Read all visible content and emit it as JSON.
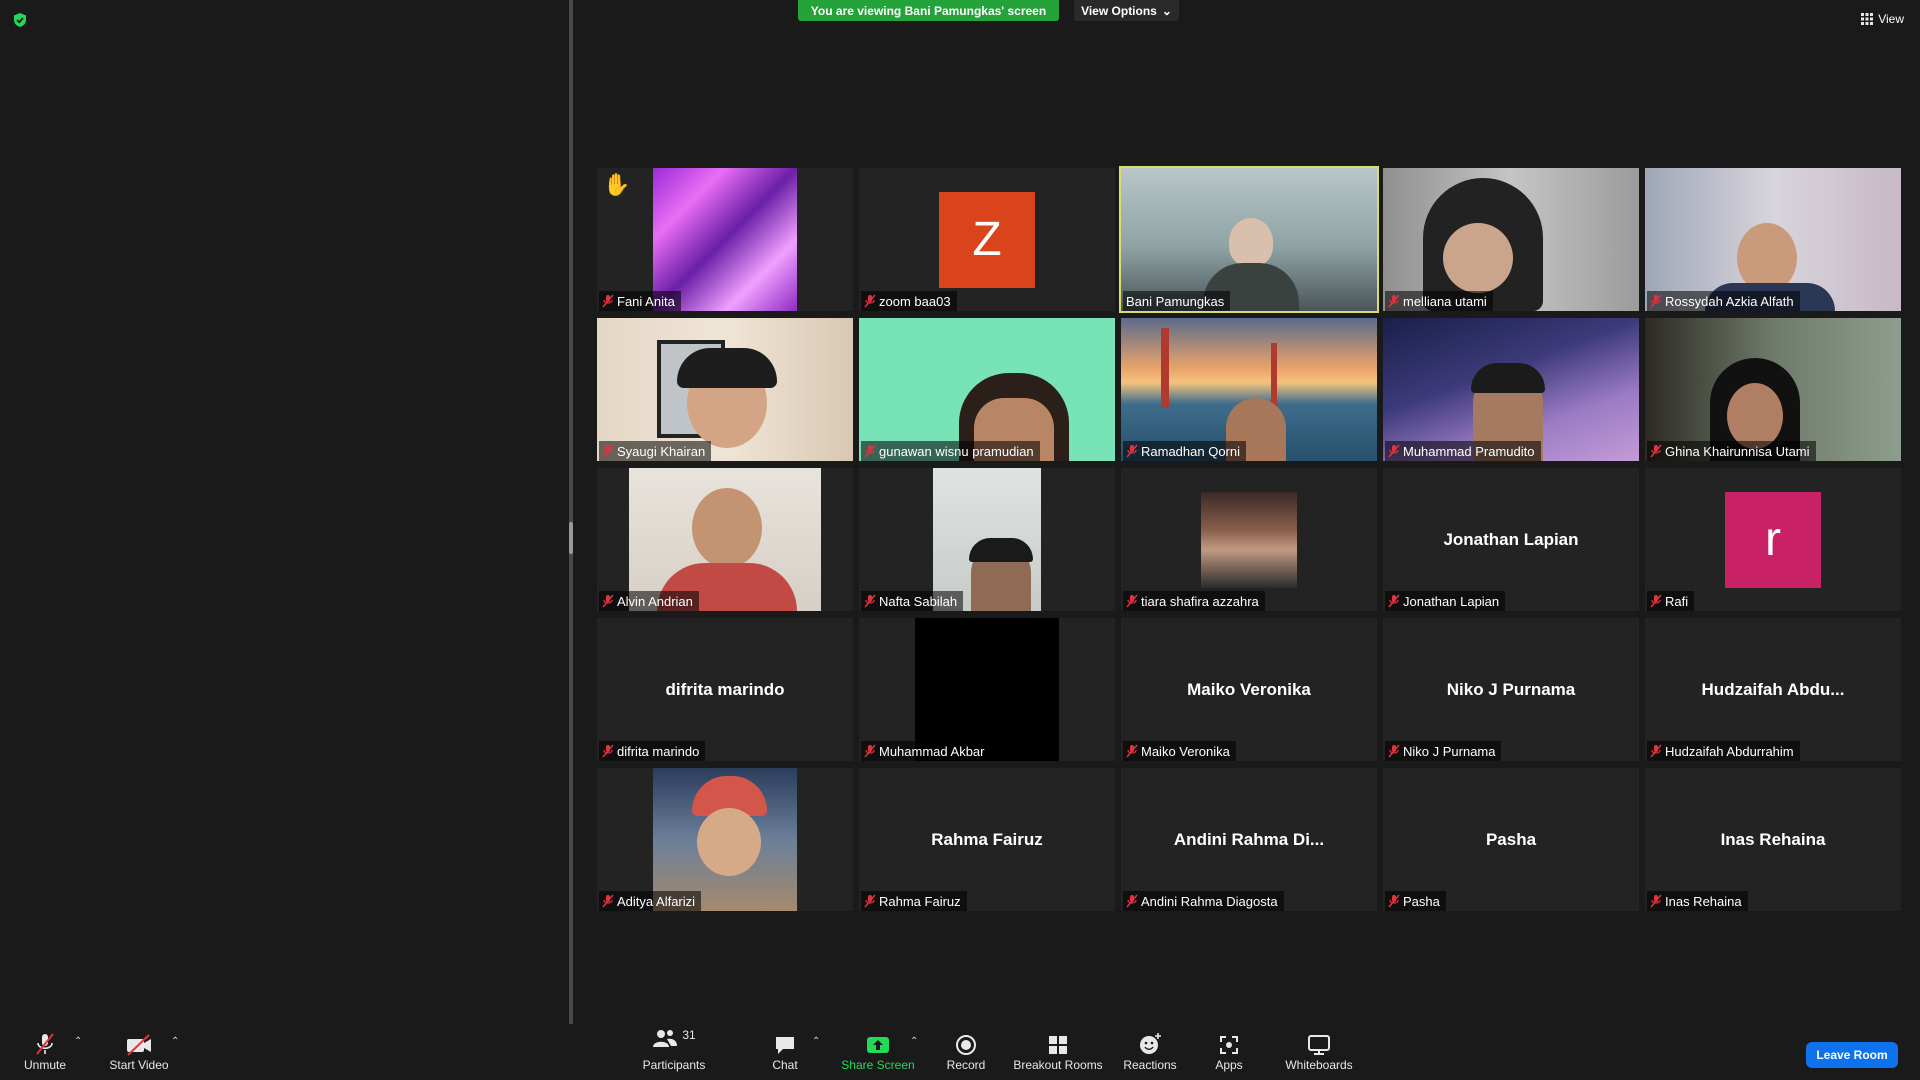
{
  "banner": {
    "viewing_text": "You are viewing Bani Pamungkas' screen",
    "view_options": "View Options"
  },
  "view_label": "View",
  "participants": [
    {
      "name": "Fani Anita",
      "raised_hand": true
    },
    {
      "name": "zoom baa03",
      "avatar_letter": "Z",
      "avatar_color": "#d9441c"
    },
    {
      "name": "Bani Pamungkas",
      "active": true
    },
    {
      "name": "melliana utami"
    },
    {
      "name": "Rossydah Azkia Alfath"
    },
    {
      "name": "Syaugi Khairan"
    },
    {
      "name": "gunawan wisnu pramudian"
    },
    {
      "name": "Ramadhan Qorni"
    },
    {
      "name": "Muhammad Pramudito"
    },
    {
      "name": "Ghina Khairunnisa Utami"
    },
    {
      "name": "Alvin Andrian"
    },
    {
      "name": "Nafta Sabilah"
    },
    {
      "name": "tiara shafira azzahra"
    },
    {
      "name": "Jonathan Lapian",
      "display_name": "Jonathan Lapian"
    },
    {
      "name": "Rafi",
      "avatar_letter": "r",
      "avatar_color": "#c92166"
    },
    {
      "name": "difrita marindo",
      "display_name": "difrita marindo"
    },
    {
      "name": "Muhammad Akbar"
    },
    {
      "name": "Maiko Veronika",
      "display_name": "Maiko Veronika"
    },
    {
      "name": "Niko J Purnama",
      "display_name": "Niko J Purnama"
    },
    {
      "name": "Hudzaifah Abdurrahim",
      "display_name": "Hudzaifah  Abdu..."
    },
    {
      "name": "Aditya Alfarizi"
    },
    {
      "name": "Rahma Fairuz",
      "display_name": "Rahma Fairuz"
    },
    {
      "name": "Andini Rahma Diagosta",
      "display_name": "Andini  Rahma  Di..."
    },
    {
      "name": "Pasha",
      "display_name": "Pasha"
    },
    {
      "name": "Inas Rehaina",
      "display_name": "Inas Rehaina"
    }
  ],
  "toolbar": {
    "unmute": "Unmute",
    "start_video": "Start Video",
    "participants": "Participants",
    "participants_count": "31",
    "chat": "Chat",
    "share_screen": "Share Screen",
    "record": "Record",
    "breakout_rooms": "Breakout Rooms",
    "reactions": "Reactions",
    "apps": "Apps",
    "whiteboards": "Whiteboards",
    "leave_room": "Leave Room"
  },
  "colors": {
    "banner_green": "#23a339",
    "active_border": "#d8de6e",
    "leave_blue": "#0e72ed",
    "muted_red": "#e0323f",
    "share_green": "#23d959"
  }
}
